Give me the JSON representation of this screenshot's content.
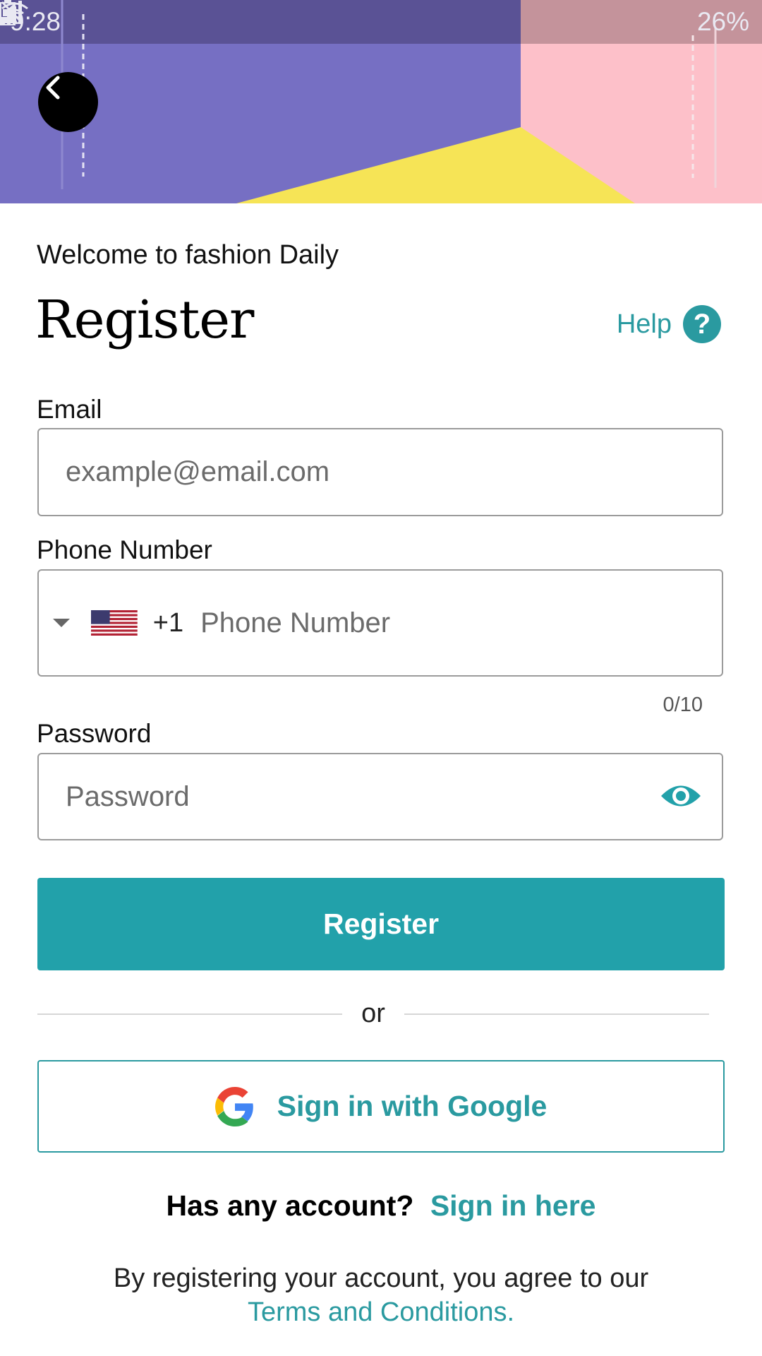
{
  "status_bar": {
    "time": "9:28",
    "battery": "26%"
  },
  "header": {
    "back_icon": "chevron-left-icon",
    "colors": {
      "purple": "#766fc3",
      "pink": "#fdc0c9",
      "yellow": "#f6e456"
    }
  },
  "intro": {
    "welcome": "Welcome to fashion Daily",
    "title": "Register",
    "help_label": "Help",
    "help_symbol": "?"
  },
  "form": {
    "email": {
      "label": "Email",
      "placeholder": "example@email.com",
      "value": ""
    },
    "phone": {
      "label": "Phone Number",
      "country_code": "+1",
      "placeholder": "Phone Number",
      "value": "",
      "counter": "0/10"
    },
    "password": {
      "label": "Password",
      "placeholder": "Password",
      "value": "",
      "toggle_icon": "eye-icon"
    },
    "register_label": "Register"
  },
  "divider": {
    "label": "or"
  },
  "google": {
    "label": "Sign in with Google"
  },
  "account": {
    "question": "Has any account?",
    "link": "Sign in here"
  },
  "terms": {
    "text": "By registering your account, you agree to our",
    "link": "Terms and Conditions."
  },
  "colors": {
    "accent": "#22a1aa",
    "link": "#2a9aa0"
  }
}
